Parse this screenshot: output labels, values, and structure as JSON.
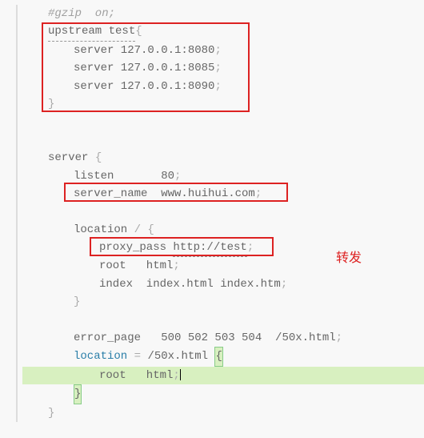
{
  "code": {
    "l1": "#gzip  on;",
    "l2_a": "upstream test",
    "l2_b": "{",
    "l3_a": "server 127.0.0.1:8080",
    "l3_b": ";",
    "l4_a": "server 127.0.0.1:8085",
    "l4_b": ";",
    "l5_a": "server 127.0.0.1:8090",
    "l5_b": ";",
    "l6": "}",
    "l7": "",
    "l8": "",
    "l9_a": "server ",
    "l9_b": "{",
    "l10_a": "listen       80",
    "l10_b": ";",
    "l11_a": "server_name  www.huihui.com",
    "l11_b": ";",
    "l12": "",
    "l13_a": "location ",
    "l13_b": "/ {",
    "l14_a": "proxy_pass ",
    "l14_b": "http://test",
    "l14_c": ";",
    "l15_a": "root   html",
    "l15_b": ";",
    "l16_a": "index  index.html index.htm",
    "l16_b": ";",
    "l17": "}",
    "l18": "",
    "l19_a": "error_page   500 502 503 504  /50x.html",
    "l19_b": ";",
    "l20_a": "location",
    "l20_b": " = ",
    "l20_c": "/50x.html ",
    "l20_d": "{",
    "l21_a": "root   html",
    "l21_b": ";",
    "l22": "}",
    "l23": "}"
  },
  "annotation": {
    "forward": "转发"
  }
}
